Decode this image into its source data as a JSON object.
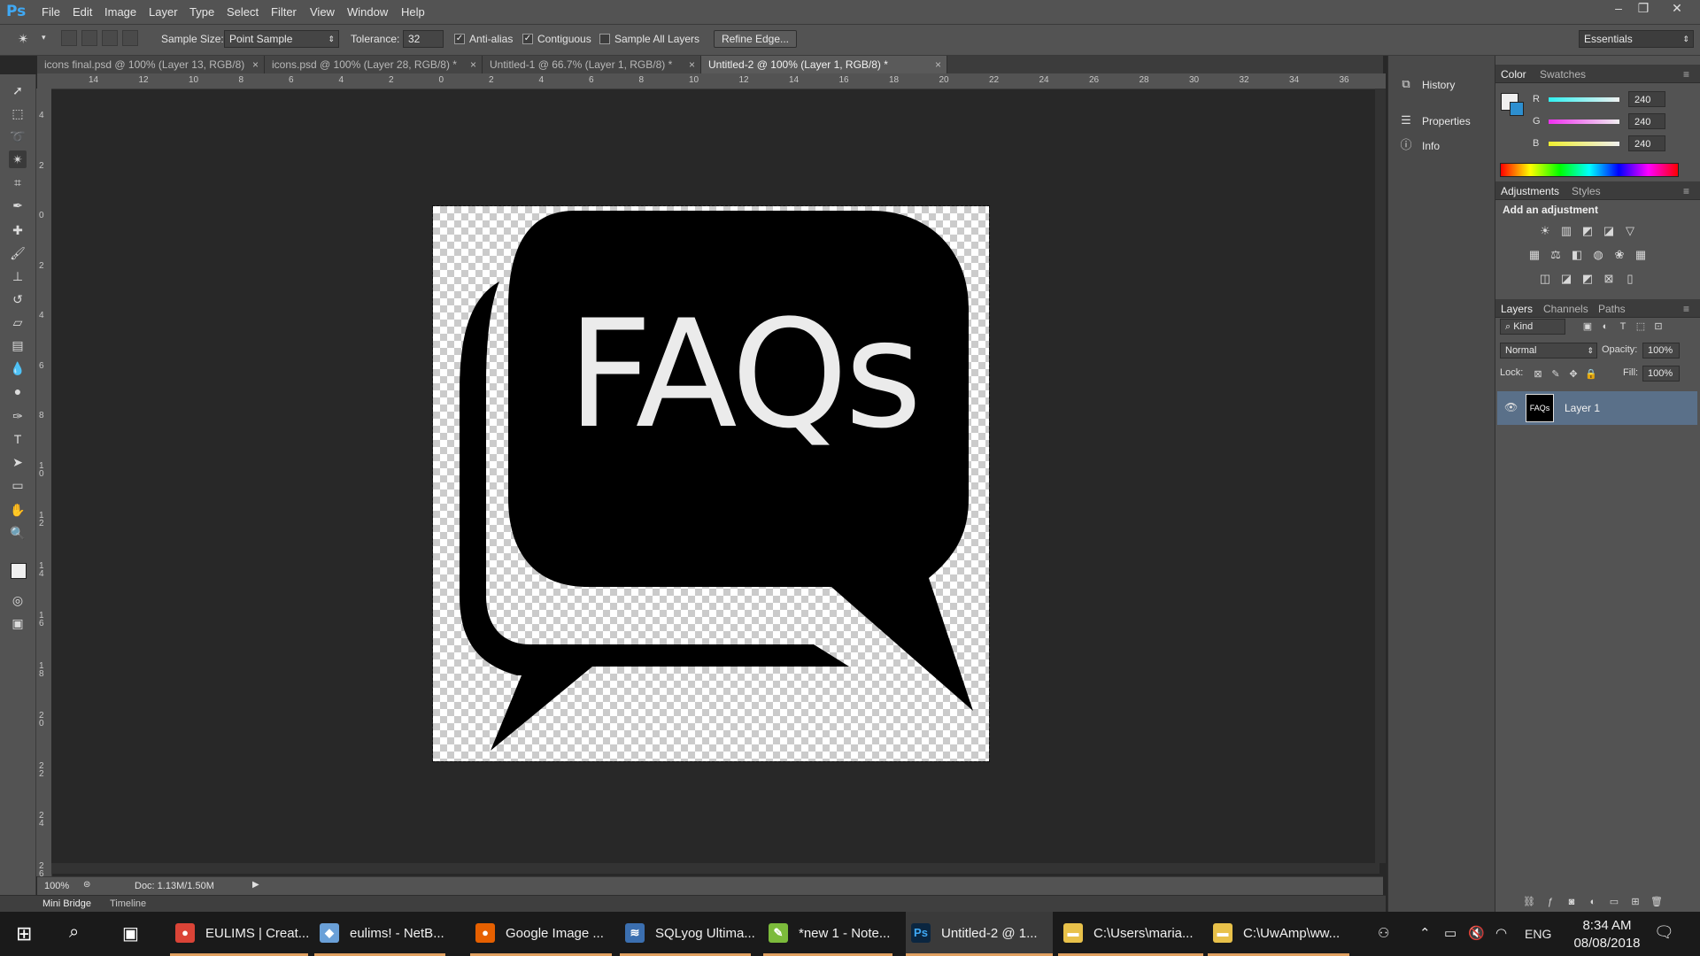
{
  "app": {
    "logo": "Ps"
  },
  "menu": [
    "File",
    "Edit",
    "Image",
    "Layer",
    "Type",
    "Select",
    "Filter",
    "View",
    "Window",
    "Help"
  ],
  "window_controls": {
    "minimize": "–",
    "restore": "❐",
    "close": "✕"
  },
  "options": {
    "sample_size_label": "Sample Size:",
    "sample_size_value": "Point Sample",
    "tolerance_label": "Tolerance:",
    "tolerance_value": "32",
    "anti_alias_label": "Anti-alias",
    "anti_alias_checked": true,
    "contiguous_label": "Contiguous",
    "contiguous_checked": true,
    "sample_all_layers_label": "Sample All Layers",
    "sample_all_layers_checked": false,
    "refine_edge_label": "Refine Edge...",
    "workspace": "Essentials"
  },
  "tabs": [
    {
      "label": "icons final.psd @ 100% (Layer 13, RGB/8)",
      "active": false
    },
    {
      "label": "icons.psd @ 100% (Layer 28, RGB/8) *",
      "active": false
    },
    {
      "label": "Untitled-1 @ 66.7% (Layer 1, RGB/8) *",
      "active": false
    },
    {
      "label": "Untitled-2 @ 100% (Layer 1, RGB/8) *",
      "active": true
    }
  ],
  "ruler_h": [
    "14",
    "12",
    "10",
    "8",
    "6",
    "4",
    "2",
    "0",
    "2",
    "4",
    "6",
    "8",
    "10",
    "12",
    "14",
    "16",
    "18",
    "20",
    "22",
    "24",
    "26",
    "28",
    "30",
    "32",
    "34",
    "36"
  ],
  "ruler_v": [
    "4",
    "2",
    "0",
    "2",
    "4",
    "6",
    "8",
    "10",
    "12",
    "14",
    "16",
    "18",
    "20",
    "22",
    "24",
    "26"
  ],
  "canvas": {
    "artwork_text": "FAQs"
  },
  "status": {
    "zoom": "100%",
    "doc": "Doc: 1.13M/1.50M"
  },
  "bottom_tabs": [
    "Mini Bridge",
    "Timeline"
  ],
  "mid_panel": [
    {
      "icon": "history-icon",
      "label": "History"
    },
    {
      "icon": "properties-icon",
      "label": "Properties"
    },
    {
      "icon": "info-icon",
      "label": "Info"
    }
  ],
  "color_panel": {
    "tabs": [
      "Color",
      "Swatches"
    ],
    "channels": [
      {
        "name": "R",
        "value": "240",
        "color": "#e0342f"
      },
      {
        "name": "G",
        "value": "240",
        "color": "#2fbf3f"
      },
      {
        "name": "B",
        "value": "240",
        "color": "#3a5fe0"
      }
    ]
  },
  "adjustments_panel": {
    "tabs": [
      "Adjustments",
      "Styles"
    ],
    "title": "Add an adjustment"
  },
  "layers_panel": {
    "tabs": [
      "Layers",
      "Channels",
      "Paths"
    ],
    "kind_label": "Kind",
    "blend_mode": "Normal",
    "opacity_label": "Opacity:",
    "opacity_value": "100%",
    "lock_label": "Lock:",
    "fill_label": "Fill:",
    "fill_value": "100%",
    "layers": [
      {
        "name": "Layer 1",
        "thumb_text": "FAQs"
      }
    ]
  },
  "taskbar": {
    "apps": [
      {
        "label": "EULIMS | Creat...",
        "icon": "chrome-icon",
        "color": "#db4437",
        "glyph": "●"
      },
      {
        "label": "eulims! - NetB...",
        "icon": "netbeans-icon",
        "color": "#6aa0d8",
        "glyph": "◆"
      },
      {
        "label": "Google Image ...",
        "icon": "firefox-icon",
        "color": "#e66000",
        "glyph": "●"
      },
      {
        "label": "SQLyog Ultima...",
        "icon": "sqlyog-icon",
        "color": "#3b6fb0",
        "glyph": "≋"
      },
      {
        "label": "*new 1 - Note...",
        "icon": "notepadpp-icon",
        "color": "#7cbb3b",
        "glyph": "✎"
      },
      {
        "label": "Untitled-2 @ 1...",
        "icon": "photoshop-icon",
        "color": "#0b2640",
        "glyph": "Ps"
      },
      {
        "label": "C:\\Users\\maria...",
        "icon": "folder-icon",
        "color": "#e8c14a",
        "glyph": "▬"
      },
      {
        "label": "C:\\UwAmp\\ww...",
        "icon": "folder-icon",
        "color": "#e8c14a",
        "glyph": "▬"
      }
    ],
    "language": "ENG",
    "time": "8:34 AM",
    "date": "08/08/2018"
  }
}
